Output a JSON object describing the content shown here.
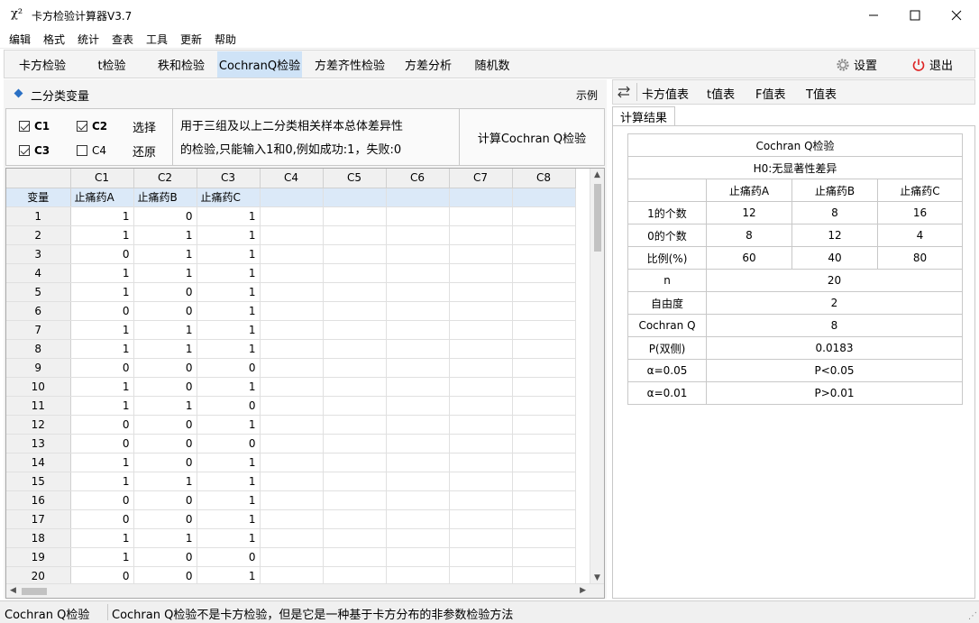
{
  "window": {
    "icon": "χ²",
    "title": "卡方检验计算器V3.7"
  },
  "menu": [
    "编辑",
    "格式",
    "统计",
    "查表",
    "工具",
    "更新",
    "帮助"
  ],
  "tabs": [
    "卡方检验",
    "t检验",
    "秩和检验",
    "CochranQ检验",
    "方差齐性检验",
    "方差分析",
    "随机数"
  ],
  "toolbar": {
    "settings": "设置",
    "exit": "退出"
  },
  "section": {
    "title": "二分类变量",
    "example": "示例"
  },
  "options": {
    "c1": "C1",
    "c2": "C2",
    "c3": "C3",
    "c4": "C4",
    "select": "选择",
    "reset": "还原",
    "desc_line1": "用于三组及以上二分类相关样本总体差异性",
    "desc_line2": "的检验,只能输入1和0,例如成功:1，失败:0",
    "calc": "计算Cochran Q检验"
  },
  "grid": {
    "columns": [
      "C1",
      "C2",
      "C3",
      "C4",
      "C5",
      "C6",
      "C7",
      "C8"
    ],
    "var_label": "变量",
    "var_names": [
      "止痛药A",
      "止痛药B",
      "止痛药C"
    ],
    "rows": [
      {
        "n": "1",
        "v": [
          "1",
          "0",
          "1"
        ]
      },
      {
        "n": "2",
        "v": [
          "1",
          "1",
          "1"
        ]
      },
      {
        "n": "3",
        "v": [
          "0",
          "1",
          "1"
        ]
      },
      {
        "n": "4",
        "v": [
          "1",
          "1",
          "1"
        ]
      },
      {
        "n": "5",
        "v": [
          "1",
          "0",
          "1"
        ]
      },
      {
        "n": "6",
        "v": [
          "0",
          "0",
          "1"
        ]
      },
      {
        "n": "7",
        "v": [
          "1",
          "1",
          "1"
        ]
      },
      {
        "n": "8",
        "v": [
          "1",
          "1",
          "1"
        ]
      },
      {
        "n": "9",
        "v": [
          "0",
          "0",
          "0"
        ]
      },
      {
        "n": "10",
        "v": [
          "1",
          "0",
          "1"
        ]
      },
      {
        "n": "11",
        "v": [
          "1",
          "1",
          "0"
        ]
      },
      {
        "n": "12",
        "v": [
          "0",
          "0",
          "1"
        ]
      },
      {
        "n": "13",
        "v": [
          "0",
          "0",
          "0"
        ]
      },
      {
        "n": "14",
        "v": [
          "1",
          "0",
          "1"
        ]
      },
      {
        "n": "15",
        "v": [
          "1",
          "1",
          "1"
        ]
      },
      {
        "n": "16",
        "v": [
          "0",
          "0",
          "1"
        ]
      },
      {
        "n": "17",
        "v": [
          "0",
          "0",
          "1"
        ]
      },
      {
        "n": "18",
        "v": [
          "1",
          "1",
          "1"
        ]
      },
      {
        "n": "19",
        "v": [
          "1",
          "0",
          "0"
        ]
      },
      {
        "n": "20",
        "v": [
          "0",
          "0",
          "1"
        ]
      }
    ]
  },
  "right_tabs": [
    "卡方值表",
    "t值表",
    "F值表",
    "T值表"
  ],
  "result_tab": "计算结果",
  "results": {
    "title": "Cochran Q检验",
    "h0": "H0:无显著性差异",
    "headers": [
      "止痛药A",
      "止痛药B",
      "止痛药C"
    ],
    "rows3": [
      {
        "label": "1的个数",
        "v": [
          "12",
          "8",
          "16"
        ]
      },
      {
        "label": "0的个数",
        "v": [
          "8",
          "12",
          "4"
        ]
      },
      {
        "label": "比例(%)",
        "v": [
          "60",
          "40",
          "80"
        ]
      }
    ],
    "rows1": [
      {
        "label": "n",
        "v": "20"
      },
      {
        "label": "自由度",
        "v": "2"
      },
      {
        "label": "Cochran Q",
        "v": "8"
      },
      {
        "label": "P(双侧)",
        "v": "0.0183"
      },
      {
        "label": "α=0.05",
        "v": "P<0.05"
      },
      {
        "label": "α=0.01",
        "v": "P>0.01"
      }
    ]
  },
  "status": {
    "left": "Cochran Q检验",
    "message": "Cochran Q检验不是卡方检验，但是它是一种基于卡方分布的非参数检验方法"
  }
}
